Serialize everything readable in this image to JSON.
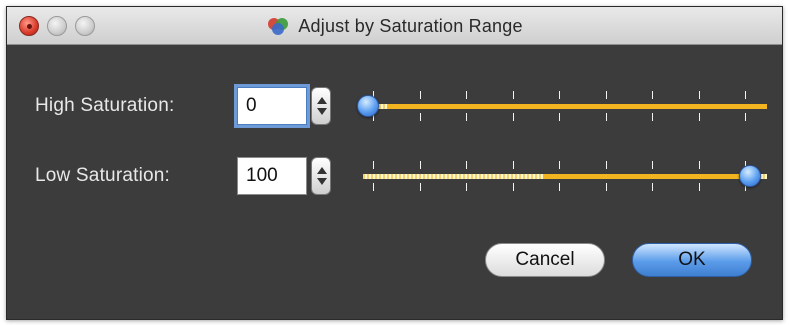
{
  "window": {
    "title": "Adjust by Saturation Range"
  },
  "high_saturation": {
    "label": "High Saturation:",
    "value": "0",
    "slider_fraction": 0.0
  },
  "low_saturation": {
    "label": "Low Saturation:",
    "value": "100",
    "slider_fraction": 1.0
  },
  "buttons": {
    "cancel_label": "Cancel",
    "ok_label": "OK"
  },
  "colors": {
    "background": "#3c3c3c",
    "accent_blue": "#5b9cea",
    "track_gold": "#f2b51f"
  }
}
